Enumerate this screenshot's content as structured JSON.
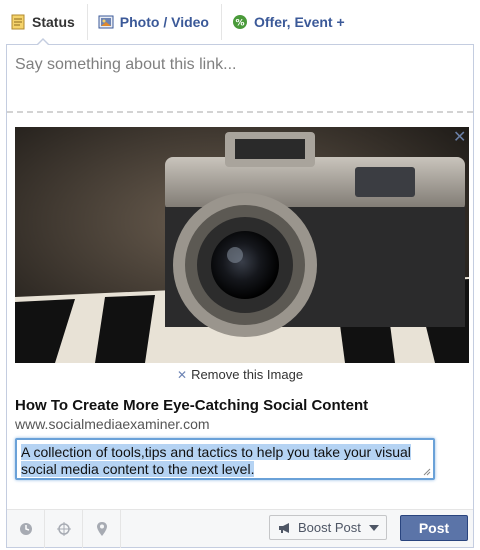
{
  "tabs": [
    {
      "label": "Status",
      "icon": "status-icon"
    },
    {
      "label": "Photo / Video",
      "icon": "photo-icon"
    },
    {
      "label": "Offer, Event +",
      "icon": "offer-icon"
    }
  ],
  "composer": {
    "placeholder": "Say something about this link...",
    "remove_image_label": "Remove this Image",
    "link_title": "How To Create More Eye-Catching Social Content",
    "link_url": "www.socialmediaexaminer.com",
    "description": "A collection of tools,tips and tactics to help you take your visual social media content to the next level.",
    "preview_image": "vintage camera on piano keys"
  },
  "footer": {
    "icons": [
      "clock-icon",
      "location-target-icon",
      "map-pin-icon"
    ],
    "boost_label": "Boost Post",
    "post_label": "Post"
  },
  "colors": {
    "link": "#3b5998",
    "post_button": "#5b74a8",
    "highlight": "#b5d3f3"
  }
}
